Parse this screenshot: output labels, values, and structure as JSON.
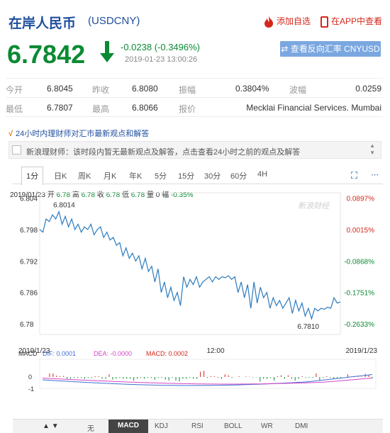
{
  "header": {
    "title": "在岸人民币",
    "code": "(USDCNY)",
    "add_watch": "添加自选",
    "app_view": "在APP中查看"
  },
  "quote": {
    "price": "6.7842",
    "change": "-0.0238 (-0.3496%)",
    "time": "2019-01-23 13:00:26",
    "reverse_button": "查看反向汇率 CNYUSD",
    "colors": {
      "down": "#0b8a34",
      "up": "#d4271b",
      "brand": "#1f4f9e"
    }
  },
  "stats": {
    "rows": [
      [
        {
          "label": "今开",
          "value": "6.8045"
        },
        {
          "label": "昨收",
          "value": "6.8080"
        },
        {
          "label": "振幅",
          "value": "0.3804%"
        },
        {
          "label": "波幅",
          "value": "0.0259"
        }
      ],
      [
        {
          "label": "最低",
          "value": "6.7807"
        },
        {
          "label": "最高",
          "value": "6.8066"
        },
        {
          "label": "报价",
          "value": "Mecklai Financial Services. Mumbai"
        }
      ]
    ]
  },
  "insight": {
    "heading": "24小时内理财师对汇市最新观点和解答",
    "message": "新浪理财师：该时段内暂无最新观点及解答，点击查看24小时之前的观点及解答"
  },
  "chart_tabs": [
    "1分",
    "日K",
    "周K",
    "月K",
    "年K",
    "5分",
    "15分",
    "30分",
    "60分",
    "4H"
  ],
  "ohlc": {
    "date": "2019/01/23",
    "open_label": "开",
    "open": "6.78",
    "high_label": "高",
    "high": "6.78",
    "close_label": "收",
    "close": "6.78",
    "low_label": "低",
    "low": "6.78",
    "vol_label": "量",
    "vol": "0",
    "amp_label": "幅",
    "amp": "-0.35%"
  },
  "chart_data": {
    "type": "line",
    "title": "",
    "xlabel": "",
    "ylabel": "",
    "ylim": [
      6.778,
      6.805
    ],
    "yticks": [
      "6.804",
      "6.798",
      "6.792",
      "6.786",
      "6.78"
    ],
    "pct_ticks": [
      "0.0897%",
      "0.0015%",
      "-0.0868%",
      "-0.1751%",
      "-0.2633%"
    ],
    "xticks": [
      "2019/1/23",
      "12:00",
      "2019/1/23"
    ],
    "watermark": "新浪财经",
    "annotations": [
      {
        "label": "6.8014"
      },
      {
        "label": "6.7810"
      }
    ],
    "series": [
      {
        "values": [
          6.798,
          6.7975,
          6.8,
          6.7995,
          6.8008,
          6.8,
          6.8014,
          6.799,
          6.8005,
          6.7985,
          6.8,
          6.798,
          6.799,
          6.7975,
          6.7985,
          6.798,
          6.799,
          6.797,
          6.798,
          6.7985,
          6.7965,
          6.7975,
          6.796,
          6.7965,
          6.795,
          6.7955,
          6.793,
          6.7945,
          6.7925,
          6.7935,
          6.792,
          6.793,
          6.7905,
          6.7925,
          6.79,
          6.791,
          6.788,
          6.7905,
          6.786,
          6.788,
          6.785,
          6.787,
          6.7845,
          6.786,
          6.7835,
          6.789,
          6.787,
          6.7885,
          6.7875,
          6.789,
          6.787,
          6.788,
          6.7885,
          6.789,
          6.788,
          6.789,
          6.7885,
          6.789,
          6.7888,
          6.7892,
          6.7885,
          6.789,
          6.786,
          6.788,
          6.785,
          6.7875,
          6.783,
          6.788,
          6.784,
          6.787,
          6.785,
          6.786,
          6.783,
          6.785,
          6.7835,
          6.7845,
          6.783,
          6.784,
          6.785,
          6.782,
          6.7845,
          6.7825,
          6.784,
          6.7815,
          6.783,
          6.781,
          6.783,
          6.7825,
          6.783,
          6.7828,
          6.7832,
          6.783,
          6.785,
          6.784,
          6.7842
        ],
        "min_index": 85,
        "max_index": 6
      }
    ],
    "macd": {
      "label": "MACD",
      "dif_label": "DIF: 0.0001",
      "dea_label": "DEA: -0.0000",
      "macd_label": "MACD: 0.0002",
      "yticks": [
        "0",
        "-1"
      ],
      "colors": {
        "dif": "#3d6fd3",
        "dea": "#d444c6",
        "up": "#d4271b",
        "down": "#0b8a34"
      }
    }
  },
  "indicator_tabs": [
    "无",
    "MACD",
    "KDJ",
    "RSI",
    "BOLL",
    "WR",
    "DMI"
  ]
}
